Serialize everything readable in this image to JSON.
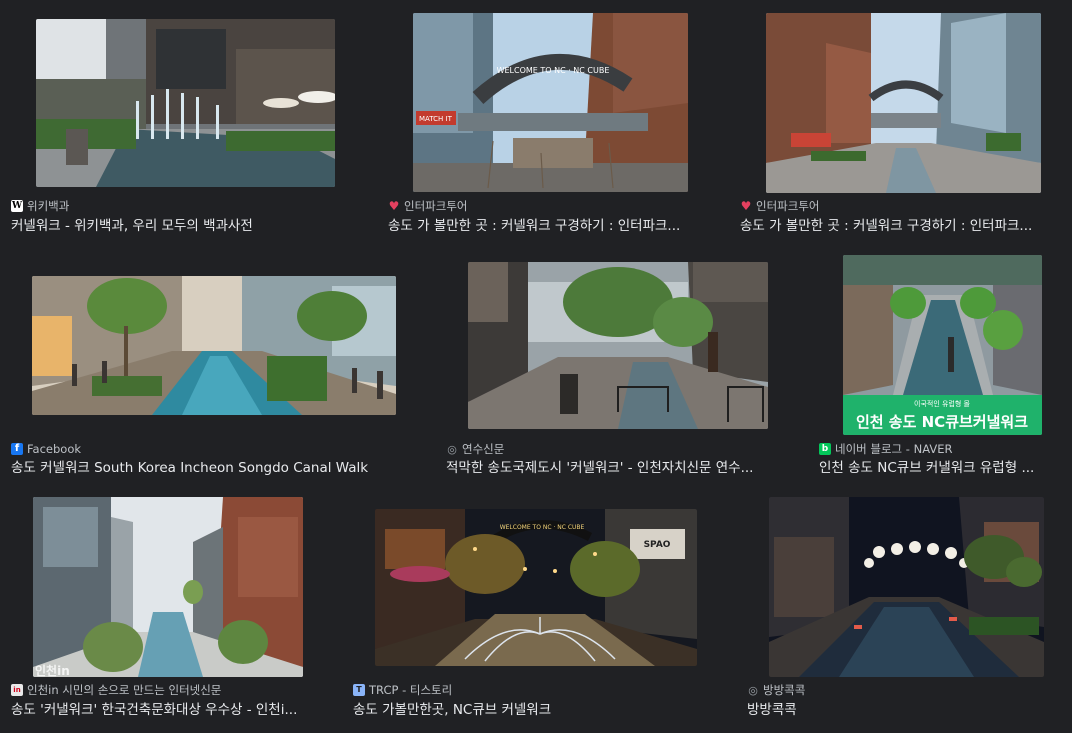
{
  "results": [
    {
      "source": "위키백과",
      "title": "커넬워크 - 위키백과, 우리 모두의 백과사전",
      "favicon": "wikipedia-icon",
      "favicon_text": "W"
    },
    {
      "source": "인터파크투어",
      "title": "송도 가 볼만한 곳 : 커넬워크 구경하기 : 인터파크...",
      "favicon": "heart-icon",
      "favicon_text": "♥"
    },
    {
      "source": "인터파크투어",
      "title": "송도 가 볼만한 곳 : 커넬워크 구경하기 : 인터파크...",
      "favicon": "heart-icon",
      "favicon_text": "♥"
    },
    {
      "source": "Facebook",
      "title": "송도 커넬워크 South Korea Incheon Songdo Canal Walk",
      "favicon": "facebook-icon",
      "favicon_text": "f"
    },
    {
      "source": "연수신문",
      "title": "적막한 송도국제도시 '커넬워크' - 인천자치신문 연수...",
      "favicon": "globe-icon",
      "favicon_text": "◎"
    },
    {
      "source": "네이버 블로그 - NAVER",
      "title": "인천 송도 NC큐브 커낼워크 유럽형 ...",
      "favicon": "naver-blog-icon",
      "favicon_text": "b"
    },
    {
      "source": "인천in 시민의 손으로 만드는 인터넷신문",
      "title": "송도 '커낼워크' 한국건축문화대상 우수상 - 인천i...",
      "favicon": "incheonin-icon",
      "favicon_text": "in"
    },
    {
      "source": "TRCP - 티스토리",
      "title": "송도 가볼만한곳, NC큐브 커넬워크",
      "favicon": "tistory-icon",
      "favicon_text": "T"
    },
    {
      "source": "방방콕콕",
      "title": "방방콕콕",
      "favicon": "globe-icon",
      "favicon_text": "◎"
    }
  ],
  "thumbnail_text": {
    "arch_sign_1": "WELCOME TO NC · NC CUBE",
    "arch_sign_2": "WELCOME TO NC · NC CUBE",
    "shop_sign_1": "MATCH IT",
    "banner_caption": "이국적인 유럽형 몰",
    "banner_title": "인천 송도 NC큐브커낼워크",
    "watermark": "인천in",
    "shop_sign_2": "SPAO"
  },
  "colors": {
    "background": "#202124",
    "title_text": "#e8eaed",
    "source_text": "#bdc1c6",
    "heart": "#e4405f",
    "facebook": "#1877f2",
    "naver": "#03c75a",
    "banner_green": "#20b26b"
  }
}
